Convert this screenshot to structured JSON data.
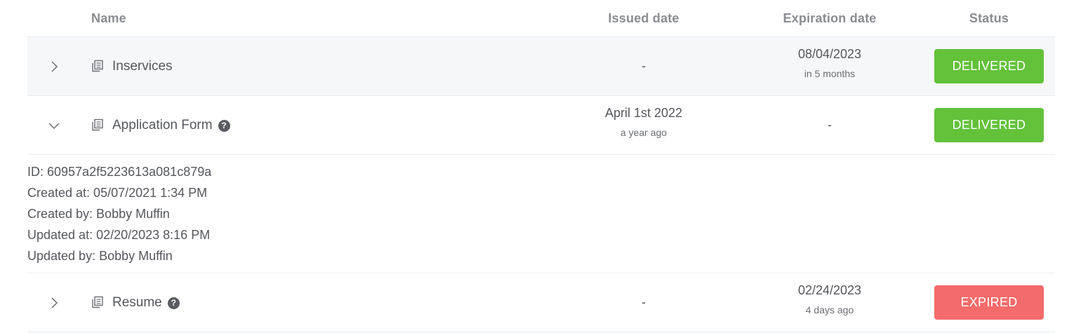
{
  "header": {
    "name": "Name",
    "issued": "Issued date",
    "expiration": "Expiration date",
    "status": "Status"
  },
  "rows": [
    {
      "name": "Inservices",
      "expanded": false,
      "has_help": false,
      "issued": "-",
      "issued_sub": "",
      "expiration": "08/04/2023",
      "expiration_sub": "in 5 months",
      "status": "DELIVERED",
      "status_color": "#63c13a"
    },
    {
      "name": "Application Form",
      "expanded": true,
      "has_help": true,
      "issued": "April 1st 2022",
      "issued_sub": "a year ago",
      "expiration": "-",
      "expiration_sub": "",
      "status": "DELIVERED",
      "status_color": "#63c13a",
      "details": {
        "id": "ID: 60957a2f5223613a081c879a",
        "created_at": "Created at: 05/07/2021 1:34 PM",
        "created_by": "Created by: Bobby Muffin",
        "updated_at": "Updated at: 02/20/2023 8:16 PM",
        "updated_by": "Updated by: Bobby Muffin"
      }
    },
    {
      "name": "Resume",
      "expanded": false,
      "has_help": true,
      "issued": "-",
      "issued_sub": "",
      "expiration": "02/24/2023",
      "expiration_sub": "4 days ago",
      "status": "EXPIRED",
      "status_color": "#f36b6b"
    }
  ],
  "icons": {
    "collapsed": "chevron-right-icon",
    "expanded": "chevron-down-icon",
    "document": "document-copy-icon",
    "help": "help-icon"
  },
  "help_glyph": "?"
}
